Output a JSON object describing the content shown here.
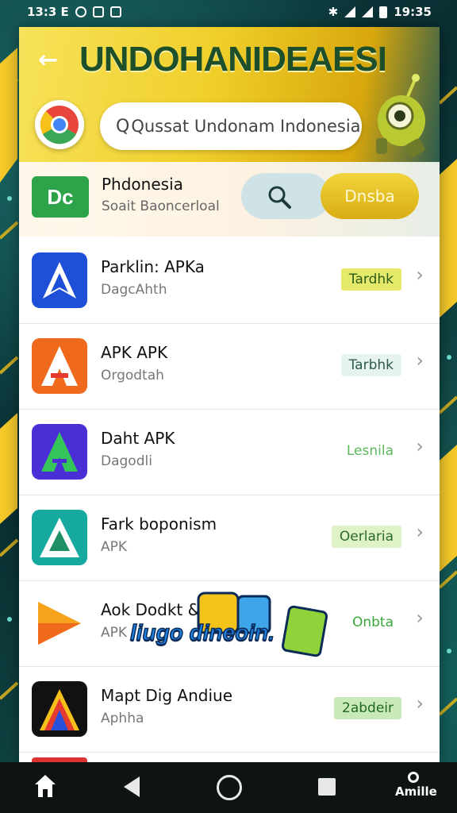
{
  "status_bar": {
    "time_left": "13:3 E",
    "time_right": "19:35"
  },
  "header": {
    "title": "UNDOHANIDEAESI",
    "search_text": "Qussat Undonam Indonesia"
  },
  "featured": {
    "icon_text": "Dc",
    "name": "Phdonesia",
    "subtitle": "Soait Baoncerloal",
    "button_label": "Dnsba"
  },
  "apps": [
    {
      "name": "Parklin: APKa",
      "sub": "DagcAhth",
      "badge": "Tardhk",
      "badge_bg": "#e6ea6a",
      "badge_fg": "#2f5a1a",
      "icon": "a-icon-blue"
    },
    {
      "name": "APK APK",
      "sub": "Orgodtah",
      "badge": "Tarbhk",
      "badge_bg": "#e7f3f1",
      "badge_fg": "#2d5a4a",
      "icon": "a-icon-orange"
    },
    {
      "name": "Daht APK",
      "sub": "Dagodli",
      "badge": "Lesnila",
      "badge_bg": "transparent",
      "badge_fg": "#5cb85c",
      "icon": "a-icon-purple"
    },
    {
      "name": "Fark boponism",
      "sub": "APK",
      "badge": "Oerlaria",
      "badge_bg": "#dff1c7",
      "badge_fg": "#2b6a2b",
      "icon": "a-icon-teal"
    },
    {
      "name": "Aok Dodkt & B",
      "sub": "APK",
      "badge": "Onbta",
      "badge_bg": "transparent",
      "badge_fg": "#3aa83a",
      "icon": "play-icon"
    },
    {
      "name": "Mapt Dig Andiue",
      "sub": "Aphha",
      "badge": "2abdeir",
      "badge_bg": "#c9eab8",
      "badge_fg": "#1f6a1f",
      "icon": "a-icon-dark"
    }
  ],
  "sticker": {
    "text": "liugo dineoin."
  },
  "nav": {
    "profile_label": "Amille"
  }
}
